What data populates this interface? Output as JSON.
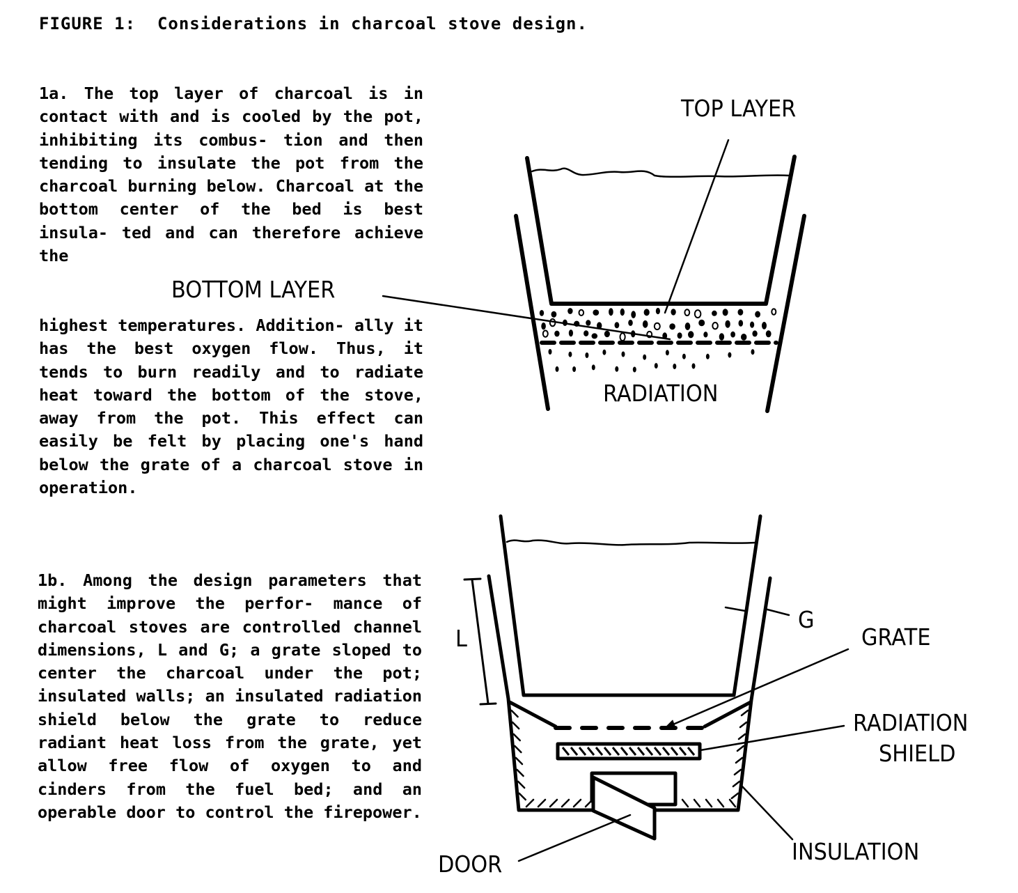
{
  "figure": {
    "title": "FIGURE 1:  Considerations in charcoal stove design."
  },
  "text": {
    "para_1a_part1": "1a. The top layer of charcoal is in contact with and is cooled by the pot, inhibiting its combus- tion and then tending to insulate the pot from the charcoal burning below.  Charcoal at the bottom center of the bed is best insula- ted and can therefore achieve the",
    "para_1a_part2": "highest temperatures. Addition- ally it has the best oxygen flow. Thus, it tends to burn readily and to radiate heat toward the bottom of the stove, away from the pot. This effect can easily be felt by placing one's hand below the grate of a charcoal stove in operation.",
    "para_1b": "1b. Among the design parameters that might improve the perfor- mance of charcoal stoves are controlled channel dimensions, L and G; a grate sloped to center the charcoal under the pot; insulated walls; an insulated radiation shield below the grate to reduce radiant heat loss from the grate, yet allow free flow of oxygen to and cinders from the fuel bed; and an operable door to control the firepower."
  },
  "diagram_1a": {
    "labels": {
      "top_layer": "TOP LAYER",
      "bottom_layer": "BOTTOM LAYER",
      "radiation": "RADIATION"
    }
  },
  "diagram_1b": {
    "labels": {
      "L": "L",
      "G": "G",
      "grate": "GRATE",
      "radiation_shield_line1": "RADIATION",
      "radiation_shield_line2": "SHIELD",
      "insulation": "INSULATION",
      "door": "DOOR"
    }
  }
}
